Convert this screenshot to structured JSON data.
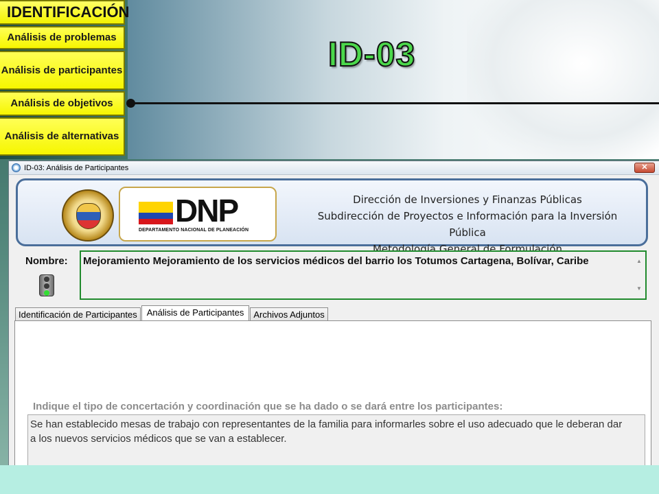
{
  "slide": {
    "nav_title": "IDENTIFICACIÓN",
    "nav_items": [
      {
        "label": "Análisis de problemas"
      },
      {
        "label": "Análisis de participantes"
      },
      {
        "label": "Análisis de objetivos"
      },
      {
        "label": "Análisis de alternativas"
      }
    ],
    "slide_title": "ID-03"
  },
  "window": {
    "title": "ID-03: Análisis de Participantes",
    "close_label": "✕",
    "banner": {
      "logo_text": "DNP",
      "logo_subtitle": "DEPARTAMENTO NACIONAL DE PLANEACIÓN",
      "lines": [
        "Dirección de Inversiones y Finanzas Públicas",
        "Subdirección de Proyectos e Información para la Inversión Pública",
        "Metodología General de Formulación"
      ]
    },
    "nombre_label": "Nombre:",
    "nombre_value": "Mejoramiento Mejoramiento de los servicios médicos del barrio los Totumos Cartagena, Bolívar, Caribe",
    "tabs": [
      {
        "label": "Identificación de Participantes",
        "active": false
      },
      {
        "label": "Análisis de Participantes",
        "active": true
      },
      {
        "label": "Archivos Adjuntos",
        "active": false
      }
    ],
    "question_label": "Indique el tipo de concertación y coordinación que se ha dado o se dará entre los participantes:",
    "answer_text": "Se han establecido mesas de trabajo con representantes de la familia para informarles sobre el uso adecuado que le deberan dar a los nuevos servicios médicos que se van a establecer."
  },
  "colors": {
    "nav_yellow": "#f6f600",
    "title_green": "#4bd84b",
    "field_border_green": "#1f8a2c",
    "banner_border": "#4a6e9a"
  }
}
